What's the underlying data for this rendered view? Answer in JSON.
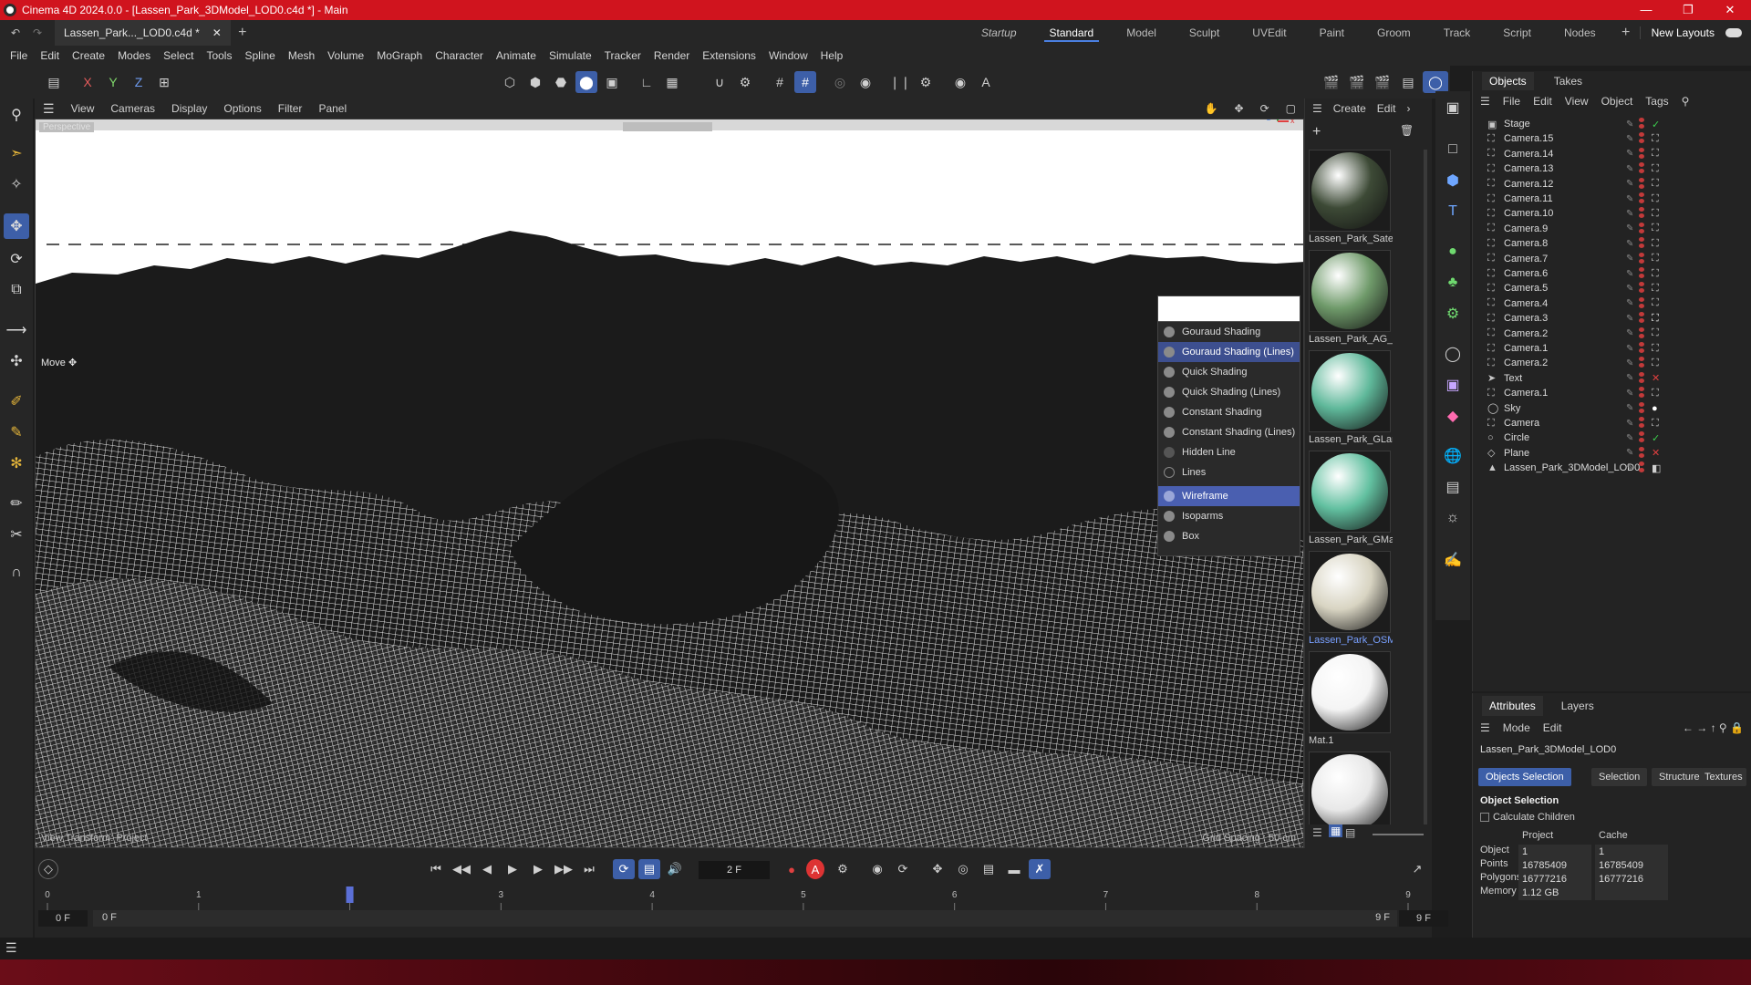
{
  "window": {
    "title": "Cinema 4D 2024.0.0 - [Lassen_Park_3DModel_LOD0.c4d *] - Main",
    "doc_tab": "Lassen_Park..._LOD0.c4d *"
  },
  "layouts": [
    "Startup",
    "Standard",
    "Model",
    "Sculpt",
    "UVEdit",
    "Paint",
    "Groom",
    "Track",
    "Script",
    "Nodes"
  ],
  "layouts_active": "Standard",
  "new_layouts": "New Layouts",
  "menubar": [
    "File",
    "Edit",
    "Create",
    "Modes",
    "Select",
    "Tools",
    "Spline",
    "Mesh",
    "Volume",
    "MoGraph",
    "Character",
    "Animate",
    "Simulate",
    "Tracker",
    "Render",
    "Extensions",
    "Window",
    "Help"
  ],
  "axis_toggles": [
    "X",
    "Y",
    "Z"
  ],
  "viewport_menu": [
    "View",
    "Cameras",
    "Display",
    "Options",
    "Filter",
    "Panel"
  ],
  "viewport": {
    "camera_label": "Perspective",
    "tool_label": "Move",
    "footer_left": "View Transform: Project",
    "footer_right": "Grid Spacing : 50 cm"
  },
  "shading_menu": {
    "items": [
      "Gouraud Shading",
      "Gouraud Shading (Lines)",
      "Quick Shading",
      "Quick Shading (Lines)",
      "Constant Shading",
      "Constant Shading (Lines)",
      "Hidden Line",
      "Lines",
      "Wireframe",
      "Isoparms",
      "Box"
    ],
    "selected": "Gouraud Shading (Lines)",
    "highlighted": "Wireframe"
  },
  "material_menu": [
    "Create",
    "Edit"
  ],
  "materials": [
    {
      "name": "Lassen_Park_Satel",
      "color": "#3d4a36"
    },
    {
      "name": "Lassen_Park_AG_L",
      "color": "#6f9a6a"
    },
    {
      "name": "Lassen_Park_GLan",
      "color": "#5fb89a"
    },
    {
      "name": "Lassen_Park_GMa",
      "color": "#62c0a0"
    },
    {
      "name": "Lassen_Park_OSM",
      "color": "#d8d4c2"
    },
    {
      "name": "Mat.1",
      "color": "#f4f4f4"
    },
    {
      "name": "",
      "color": "#e8e8e8"
    }
  ],
  "objects": {
    "tabs": [
      "Objects",
      "Takes"
    ],
    "menu": [
      "File",
      "Edit",
      "View",
      "Object",
      "Tags"
    ],
    "rows": [
      {
        "name": "Stage",
        "icon": "stage-icon",
        "tag": "✓",
        "tagcolor": "#3ccf4e"
      },
      {
        "name": "Camera.15",
        "icon": "camera-icon",
        "tag": "⛶",
        "tagcolor": "#cfcfcf"
      },
      {
        "name": "Camera.14",
        "icon": "camera-icon",
        "tag": "⛶",
        "tagcolor": "#cfcfcf"
      },
      {
        "name": "Camera.13",
        "icon": "camera-icon",
        "tag": "⛶",
        "tagcolor": "#cfcfcf"
      },
      {
        "name": "Camera.12",
        "icon": "camera-icon",
        "tag": "⛶",
        "tagcolor": "#cfcfcf"
      },
      {
        "name": "Camera.11",
        "icon": "camera-icon",
        "tag": "⛶",
        "tagcolor": "#cfcfcf"
      },
      {
        "name": "Camera.10",
        "icon": "camera-icon",
        "tag": "⛶",
        "tagcolor": "#cfcfcf"
      },
      {
        "name": "Camera.9",
        "icon": "camera-icon",
        "tag": "⛶",
        "tagcolor": "#cfcfcf"
      },
      {
        "name": "Camera.8",
        "icon": "camera-icon",
        "tag": "⛶",
        "tagcolor": "#cfcfcf"
      },
      {
        "name": "Camera.7",
        "icon": "camera-icon",
        "tag": "⛶",
        "tagcolor": "#cfcfcf"
      },
      {
        "name": "Camera.6",
        "icon": "camera-icon",
        "tag": "⛶",
        "tagcolor": "#cfcfcf"
      },
      {
        "name": "Camera.5",
        "icon": "camera-icon",
        "tag": "⛶",
        "tagcolor": "#cfcfcf"
      },
      {
        "name": "Camera.4",
        "icon": "camera-icon",
        "tag": "⛶",
        "tagcolor": "#cfcfcf"
      },
      {
        "name": "Camera.3",
        "icon": "camera-icon",
        "tag": "⛶",
        "tagcolor": "#ffffff"
      },
      {
        "name": "Camera.2",
        "icon": "camera-icon",
        "tag": "⛶",
        "tagcolor": "#cfcfcf"
      },
      {
        "name": "Camera.1",
        "icon": "camera-icon",
        "tag": "⛶",
        "tagcolor": "#cfcfcf"
      },
      {
        "name": "Camera.2",
        "icon": "camera-icon",
        "tag": "⛶",
        "tagcolor": "#cfcfcf"
      },
      {
        "name": "Text",
        "icon": "text-icon",
        "tag": "✕",
        "tagcolor": "#e04040"
      },
      {
        "name": "Camera.1",
        "icon": "camera-icon",
        "tag": "⛶",
        "tagcolor": "#cfcfcf"
      },
      {
        "name": "Sky",
        "icon": "sky-icon",
        "tag": "●",
        "tagcolor": "#ffffff"
      },
      {
        "name": "Camera",
        "icon": "camera-icon",
        "tag": "⛶",
        "tagcolor": "#cfcfcf"
      },
      {
        "name": "Circle",
        "icon": "circle-icon",
        "tag": "✓",
        "tagcolor": "#3ccf4e"
      },
      {
        "name": "Plane",
        "icon": "plane-icon",
        "tag": "✕",
        "tagcolor": "#e04040"
      },
      {
        "name": "Lassen_Park_3DModel_LOD0",
        "icon": "polygon-object-icon",
        "tag": "◧",
        "tagcolor": "#cfcfcf"
      }
    ]
  },
  "attributes": {
    "tabs": [
      "Attributes",
      "Layers"
    ],
    "menu": [
      "Mode",
      "Edit"
    ],
    "object_name": "Lassen_Park_3DModel_LOD0",
    "buttons": [
      "Objects Selection",
      "Selection",
      "Structure",
      "Textures"
    ],
    "section": "Object Selection",
    "checkbox": "Calculate Children",
    "col_headers": [
      "Project",
      "Cache"
    ],
    "rows": [
      {
        "label": "Object",
        "project": "1",
        "cache": "1"
      },
      {
        "label": "Points",
        "project": "16785409",
        "cache": "16785409"
      },
      {
        "label": "Polygons",
        "project": "16777216",
        "cache": "16777216"
      },
      {
        "label": "Memory",
        "project": "1.12 GB",
        "cache": ""
      }
    ]
  },
  "timeline": {
    "current_frame": "2 F",
    "ruler": [
      "0",
      "1",
      "2",
      "3",
      "4",
      "5",
      "6",
      "7",
      "8",
      "9"
    ],
    "playhead_frame": 2,
    "range_start": "0 F",
    "range_start2": "0 F",
    "range_end": "9 F",
    "range_end2": "9 F"
  }
}
